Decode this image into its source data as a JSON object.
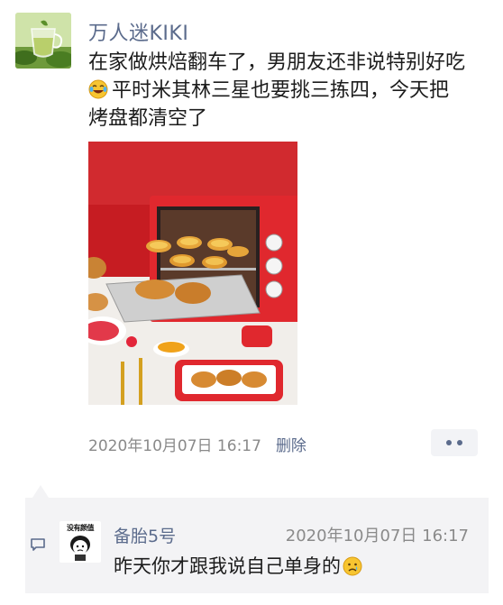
{
  "post": {
    "author_name": "万人迷KIKI",
    "text_line1": "在家做烘焙翻车了，男朋友还非说特别好吃",
    "text_line2": "平时米其林三星也要挑三拣四，今天把",
    "text_line3": "烤盘都清空了",
    "text_emoji": "laughing-with-tears-emoji",
    "timestamp": "2020年10月07日 16:17",
    "delete_label": "删除",
    "photo_subject": "red toaster oven with egg tarts and croissants"
  },
  "comment": {
    "commenter_name": "备胎5号",
    "commenter_avatar_caption": "没有颜值",
    "timestamp": "2020年10月07日 16:17",
    "text": "昨天你才跟我说自己单身的",
    "text_emoji": "sad-tear-emoji"
  },
  "icons": {
    "more": "more-dots-icon",
    "comment": "comment-bubble-icon"
  },
  "colors": {
    "link_blue": "#5b6b8c",
    "meta_gray": "#8a8a8a",
    "comment_bg": "#f3f3f5",
    "oven_red": "#d6262b"
  }
}
